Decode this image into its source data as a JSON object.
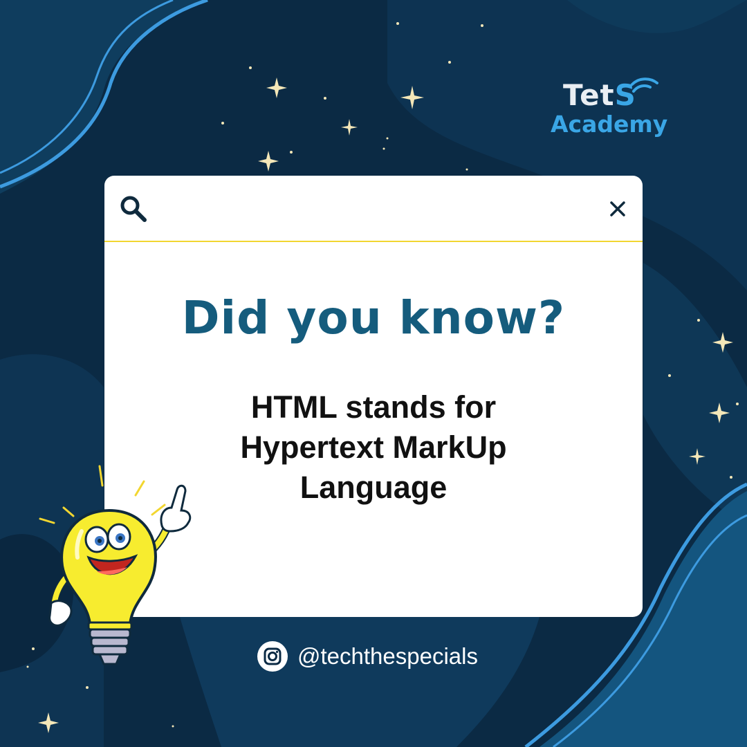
{
  "logo": {
    "line1_a": "Tet",
    "line1_b": "S",
    "line2": "Academy",
    "colors": {
      "light": "#e9eef3",
      "accent": "#3aa6e6"
    }
  },
  "card": {
    "headline": "Did you know?",
    "body_lines": [
      "HTML stands for",
      "Hypertext MarkUp",
      "Language"
    ],
    "icons": {
      "left": "search-icon",
      "right": "close-icon"
    }
  },
  "footer": {
    "handle": "@techthespecials",
    "icon": "instagram-icon"
  },
  "colors": {
    "background": "#0b2a44",
    "headline": "#155c7d",
    "divider": "#f2d630",
    "mascot": "#f7ec2f"
  }
}
